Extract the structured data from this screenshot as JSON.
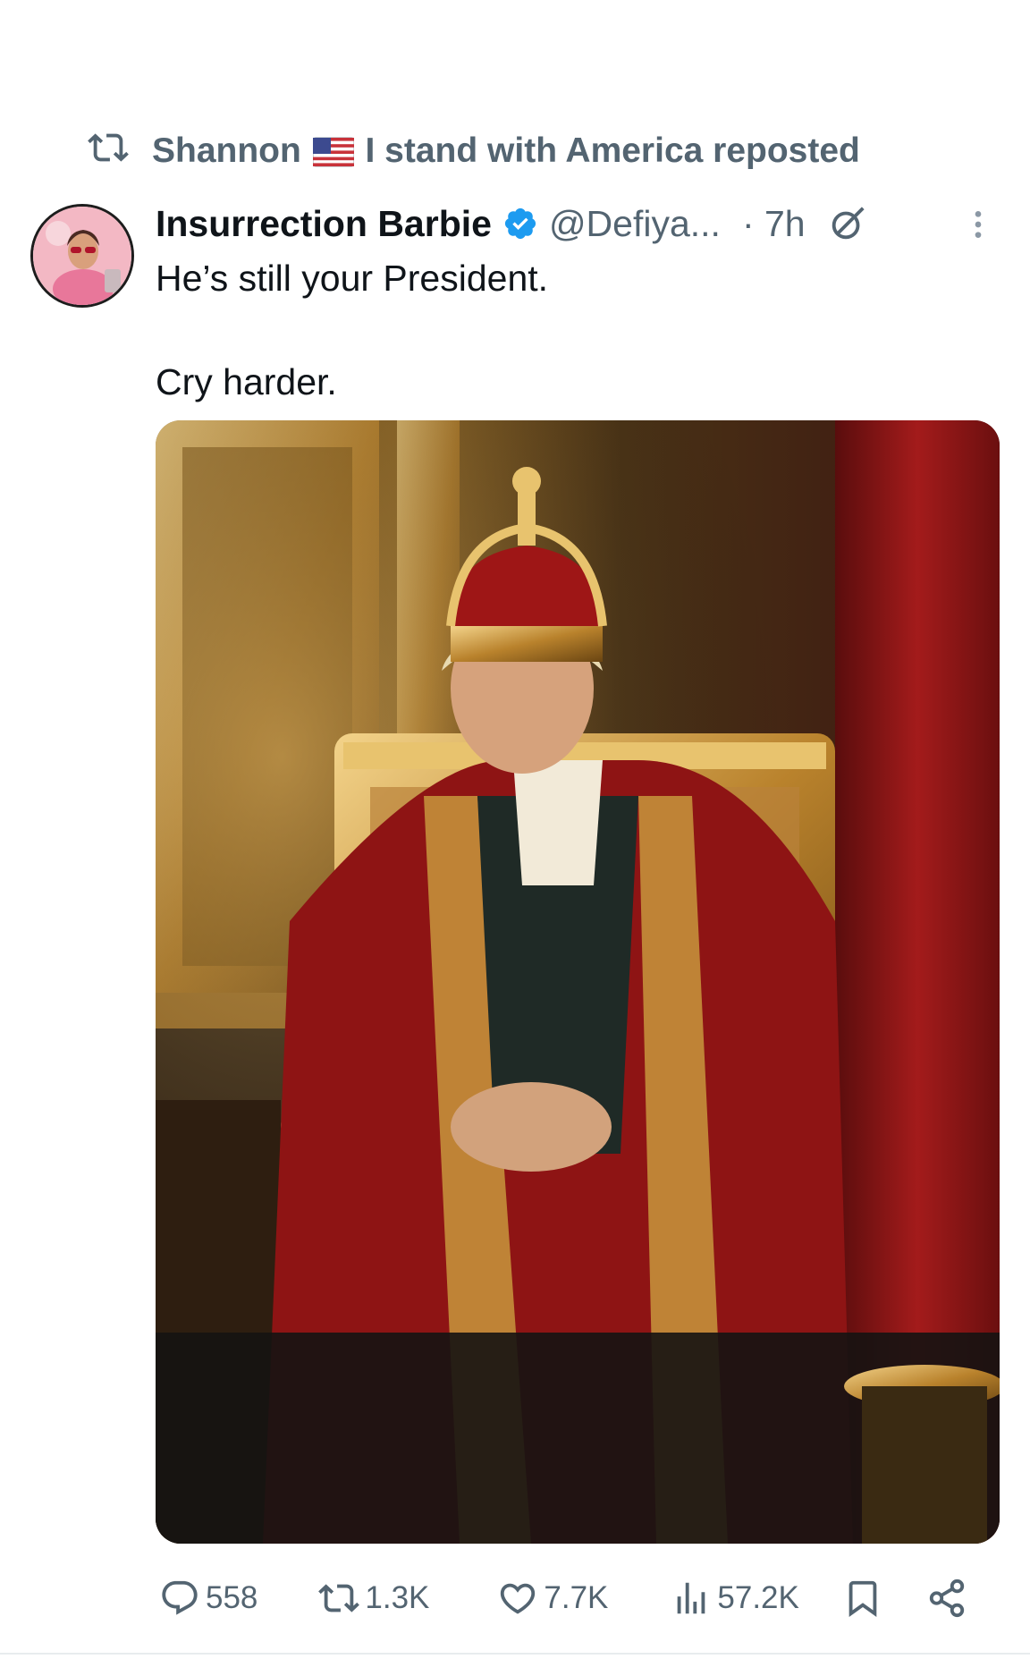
{
  "repost": {
    "icon": "repost-icon",
    "user": "Shannon",
    "flag_icon": "us-flag-icon",
    "text": "I stand with America reposted"
  },
  "post": {
    "author_name": "Insurrection Barbie",
    "verified_icon": "verified-badge-icon",
    "handle": "@Defiya...",
    "time": "· 7h",
    "grok_icon": "grok-icon",
    "more_icon": "more-icon",
    "text": "He’s still your President.\n\nCry harder.",
    "media": "image-king-on-throne"
  },
  "actions": {
    "replies": "558",
    "reposts": "1.3K",
    "likes": "7.7K",
    "views": "57.2K"
  },
  "colors": {
    "text": "#0f1419",
    "muted": "#536471",
    "verified": "#1d9bf0"
  }
}
